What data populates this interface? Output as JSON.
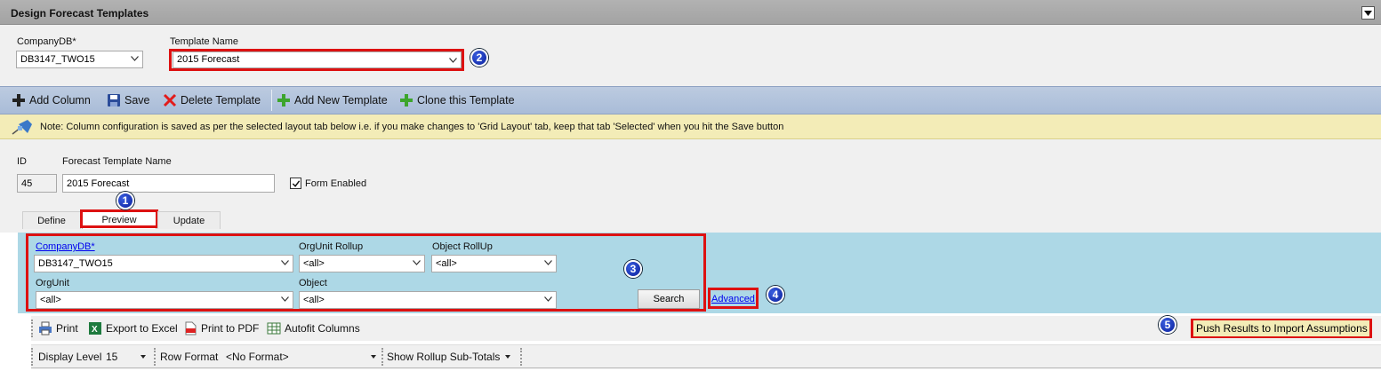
{
  "window": {
    "title": "Design Forecast Templates"
  },
  "header": {
    "company_label": "CompanyDB*",
    "company_value": "DB3147_TWO15",
    "template_label": "Template Name",
    "template_value": "2015 Forecast"
  },
  "toolbar": {
    "add_column": "Add Column",
    "save": "Save",
    "delete_template": "Delete Template",
    "add_new_template": "Add New Template",
    "clone_template": "Clone this Template"
  },
  "note": {
    "text": "Note: Column configuration is saved as per the selected layout tab below i.e. if you make changes to 'Grid Layout' tab, keep that tab 'Selected' when you hit the Save button"
  },
  "form": {
    "id_label": "ID",
    "id_value": "45",
    "name_label": "Forecast Template Name",
    "name_value": "2015 Forecast",
    "form_enabled_label": "Form Enabled",
    "form_enabled": true
  },
  "tabs": [
    {
      "label": "Define"
    },
    {
      "label": "Preview"
    },
    {
      "label": "Update"
    }
  ],
  "filters": {
    "company_label": "CompanyDB*",
    "company_value": "DB3147_TWO15",
    "orgunit_rollup_label": "OrgUnit Rollup",
    "orgunit_rollup_value": "<all>",
    "object_rollup_label": "Object RollUp",
    "object_rollup_value": "<all>",
    "orgunit_label": "OrgUnit",
    "orgunit_value": "<all>",
    "object_label": "Object",
    "object_value": "<all>",
    "search": "Search",
    "advanced": "Advanced"
  },
  "grid_toolbar": {
    "print": "Print",
    "export_excel": "Export to Excel",
    "print_pdf": "Print to PDF",
    "autofit": "Autofit Columns",
    "push_results": "Push Results to Import Assumptions"
  },
  "grid_toolbar2": {
    "display_level_label": "Display Level",
    "display_level_value": "15",
    "row_format_label": "Row Format",
    "row_format_value": "<No Format>",
    "show_rollup": "Show Rollup Sub-Totals"
  },
  "badges": [
    "1",
    "2",
    "3",
    "4",
    "5"
  ],
  "colors": {
    "titlebar": "#a8a8a8",
    "toolbar": "#b0c2dc",
    "note_bg": "#f3ecb7",
    "filter_panel": "#add8e6",
    "highlight_red": "#dd1111",
    "badge_blue": "#0a1f9c"
  }
}
